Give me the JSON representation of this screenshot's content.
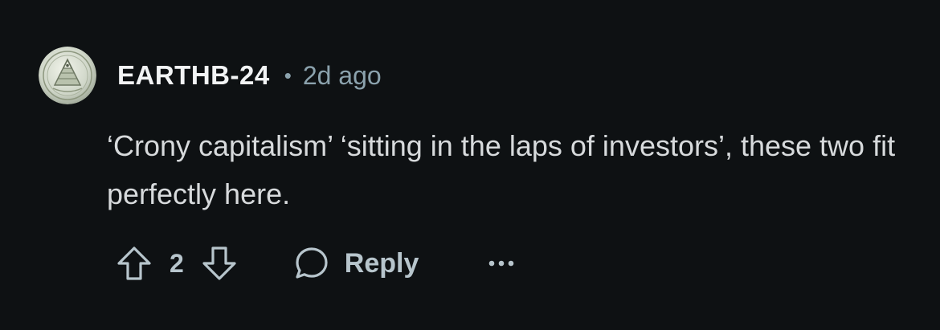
{
  "comment": {
    "author": "EARTHB-24",
    "separator": "•",
    "timestamp": "2d ago",
    "avatar_icon": "pyramid-eye-coin-icon",
    "text": "‘Crony capitalism’ ‘sitting in the laps of investors’, these two fit perfectly here."
  },
  "actions": {
    "upvote_icon": "arrow-up-icon",
    "vote_count": "2",
    "downvote_icon": "arrow-down-icon",
    "reply_icon": "speech-bubble-icon",
    "reply_label": "Reply",
    "more_icon": "ellipsis-icon"
  },
  "colors": {
    "background": "#0e1113",
    "username": "#f2f4f5",
    "meta": "#8ba2ad",
    "body": "#d7dadc",
    "action": "#b7c5cc"
  }
}
